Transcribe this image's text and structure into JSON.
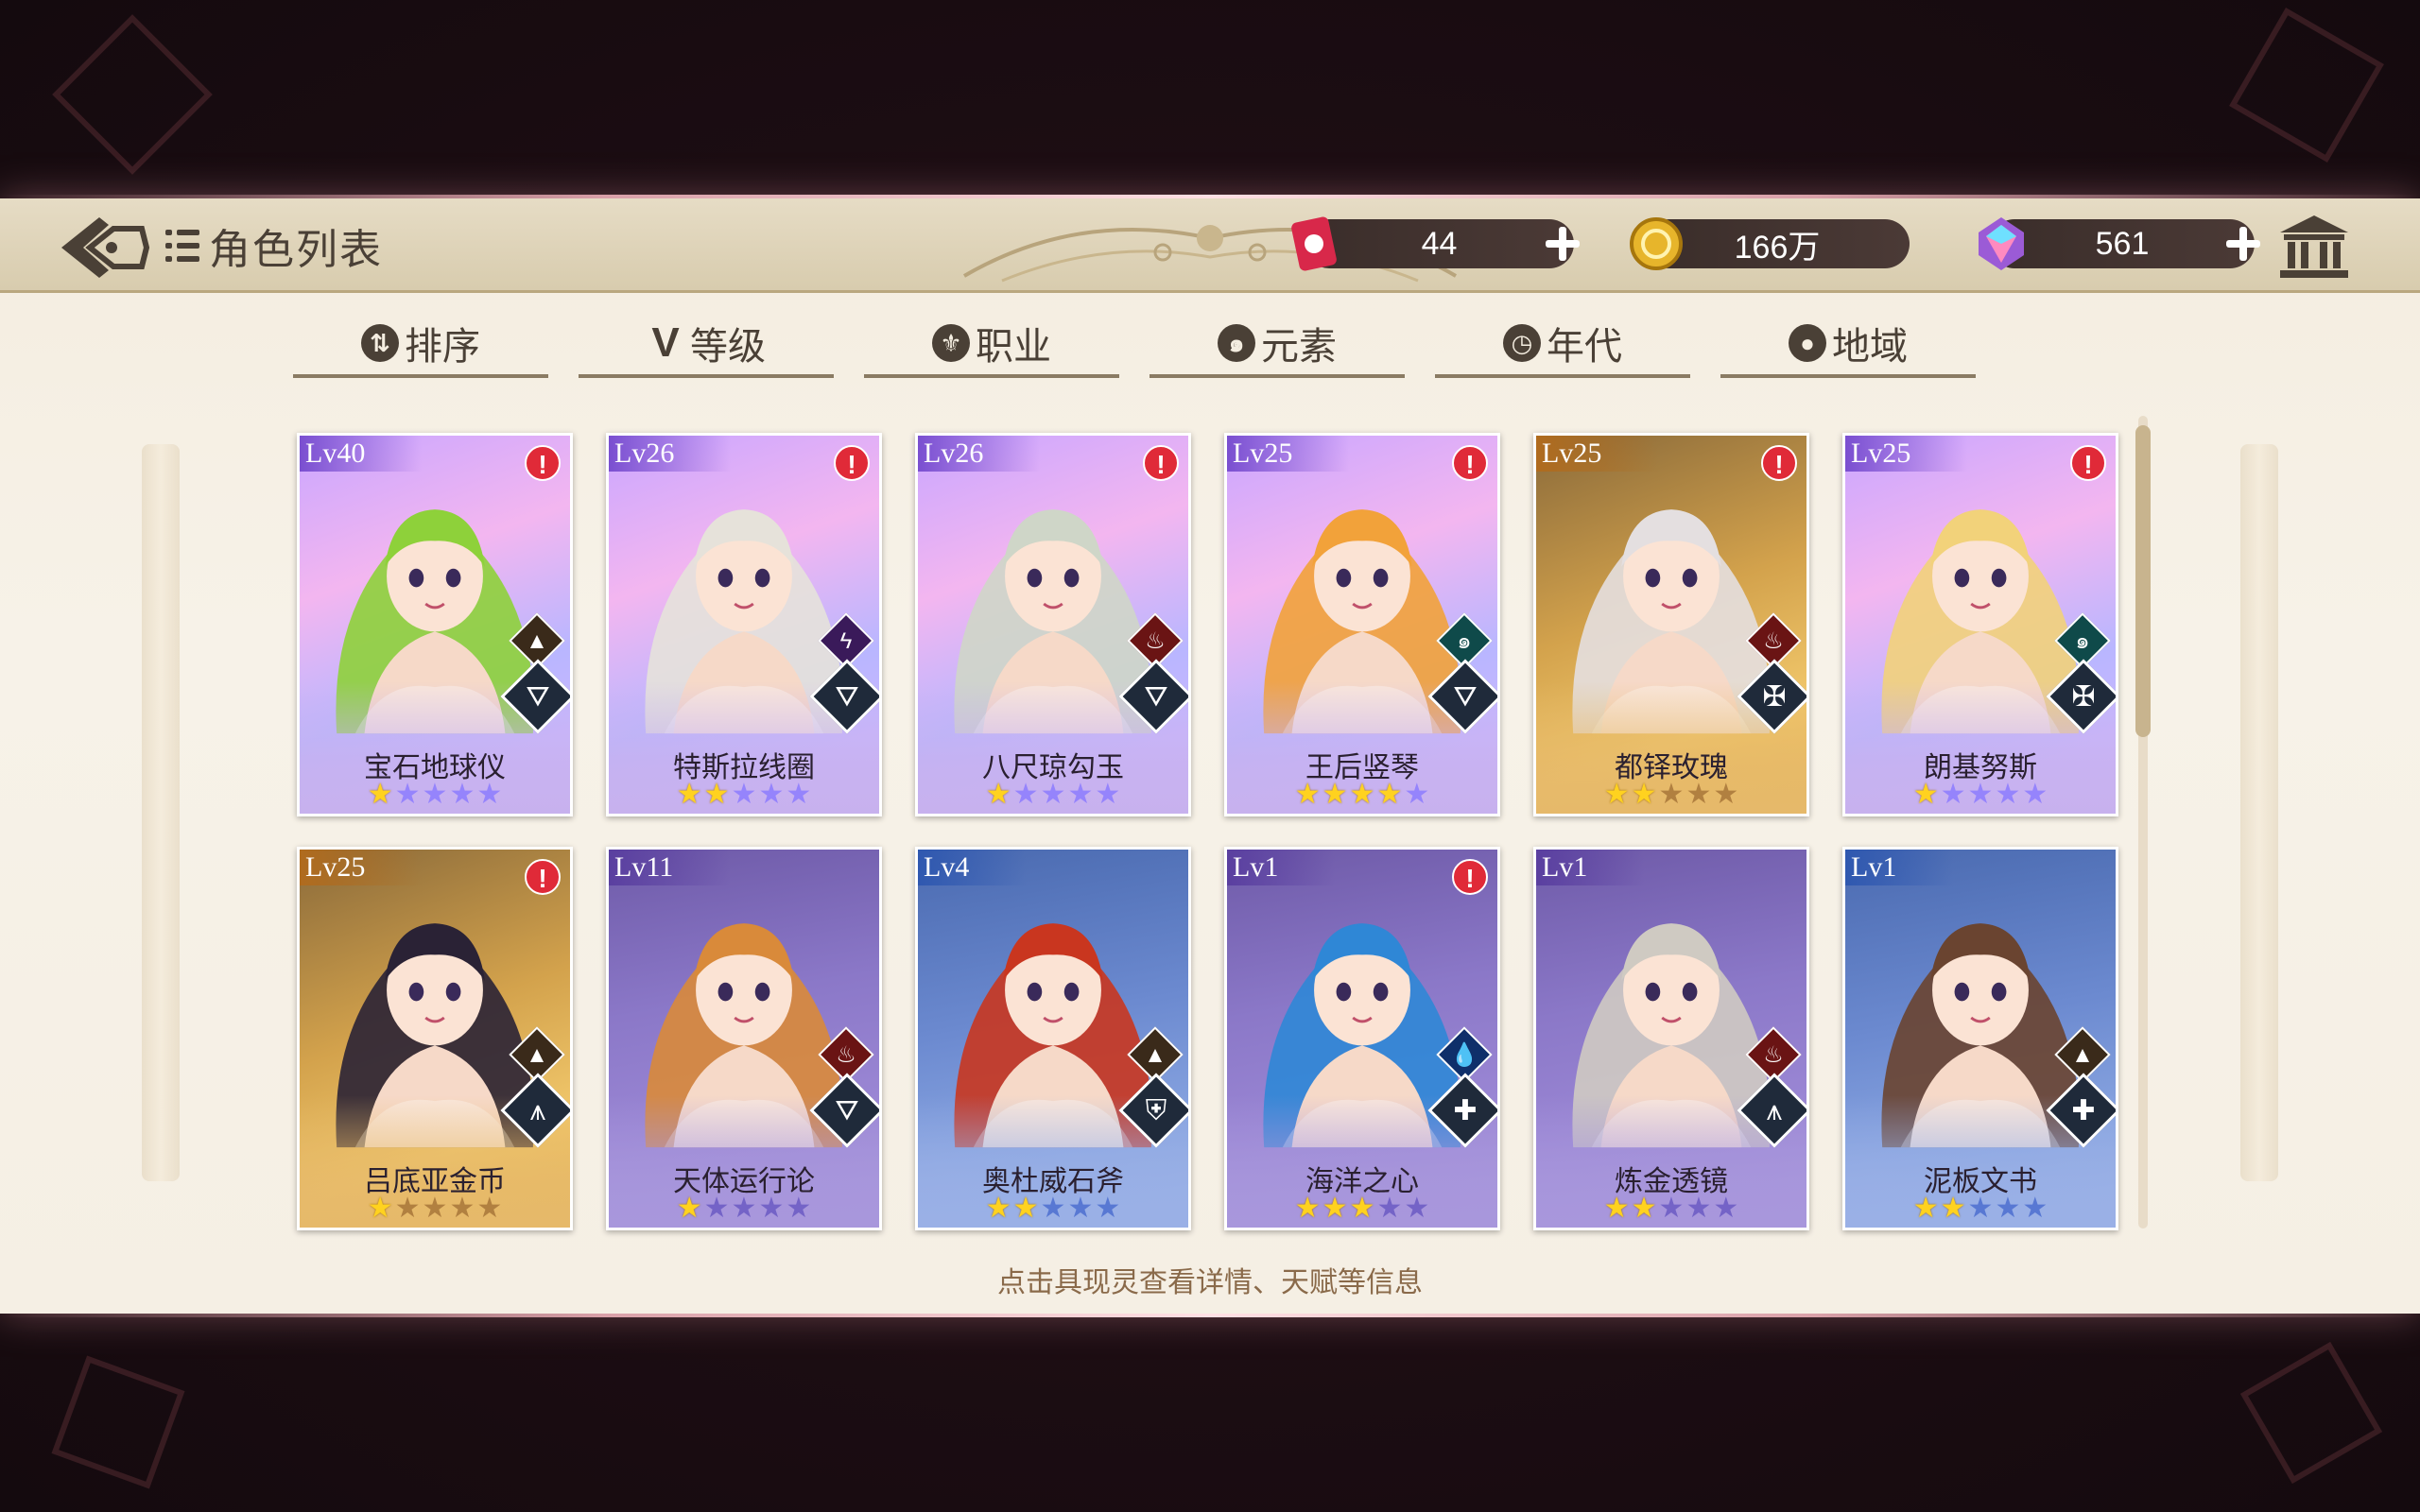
{
  "header": {
    "title": "角色列表",
    "resources": [
      {
        "name": "ticket",
        "value": "44"
      },
      {
        "name": "gold",
        "value": "166万"
      },
      {
        "name": "gem",
        "value": "561"
      }
    ]
  },
  "filters": [
    {
      "label": "排序",
      "icon": "sort-icon"
    },
    {
      "label": "等级",
      "icon": "level-icon"
    },
    {
      "label": "职业",
      "icon": "class-icon"
    },
    {
      "label": "元素",
      "icon": "element-icon"
    },
    {
      "label": "年代",
      "icon": "era-icon"
    },
    {
      "label": "地域",
      "icon": "location-icon"
    }
  ],
  "cards": [
    {
      "level": "Lv40",
      "name": "宝石地球仪",
      "stars": 1,
      "alert": true,
      "theme": "purple",
      "element": "earth",
      "job": "mage",
      "hair": "#8ed13a"
    },
    {
      "level": "Lv26",
      "name": "特斯拉线圈",
      "stars": 2,
      "alert": true,
      "theme": "purple",
      "element": "thunder",
      "job": "mage",
      "hair": "#e6e2da"
    },
    {
      "level": "Lv26",
      "name": "八尺琼勾玉",
      "stars": 1,
      "alert": true,
      "theme": "purple",
      "element": "fire",
      "job": "mage",
      "hair": "#cfd6c8"
    },
    {
      "level": "Lv25",
      "name": "王后竖琴",
      "stars": 4,
      "alert": true,
      "theme": "purple",
      "element": "wind",
      "job": "mage",
      "hair": "#f2a23a"
    },
    {
      "level": "Lv25",
      "name": "都铎玫瑰",
      "stars": 2,
      "alert": true,
      "theme": "gold",
      "element": "fire",
      "job": "sword",
      "hair": "#e4dfe0"
    },
    {
      "level": "Lv25",
      "name": "朗基努斯",
      "stars": 1,
      "alert": true,
      "theme": "purple",
      "element": "wind",
      "job": "sword",
      "hair": "#f2d27a"
    },
    {
      "level": "Lv25",
      "name": "吕底亚金币",
      "stars": 1,
      "alert": true,
      "theme": "gold",
      "element": "earth",
      "job": "archer",
      "hair": "#2a2235"
    },
    {
      "level": "Lv11",
      "name": "天体运行论",
      "stars": 1,
      "alert": false,
      "theme": "violet",
      "element": "fire",
      "job": "mage",
      "hair": "#d98a3a"
    },
    {
      "level": "Lv4",
      "name": "奥杜威石斧",
      "stars": 2,
      "alert": false,
      "theme": "blue",
      "element": "earth",
      "job": "shield",
      "hair": "#c9361f"
    },
    {
      "level": "Lv1",
      "name": "海洋之心",
      "stars": 3,
      "alert": true,
      "theme": "violet",
      "element": "water",
      "job": "healer",
      "hair": "#2f87d6"
    },
    {
      "level": "Lv1",
      "name": "炼金透镜",
      "stars": 2,
      "alert": false,
      "theme": "violet",
      "element": "fire",
      "job": "archer",
      "hair": "#cfcac2"
    },
    {
      "level": "Lv1",
      "name": "泥板文书",
      "stars": 2,
      "alert": false,
      "theme": "blue",
      "element": "earth",
      "job": "healer",
      "hair": "#6a4430"
    }
  ],
  "hint": "点击具现灵查看详情、天赋等信息",
  "colors": {
    "panel": "#f4ede0",
    "topbar": "#dcd0b4",
    "text_dark": "#4a4036",
    "alert": "#e02a38",
    "star_on": "#ffd21f"
  }
}
